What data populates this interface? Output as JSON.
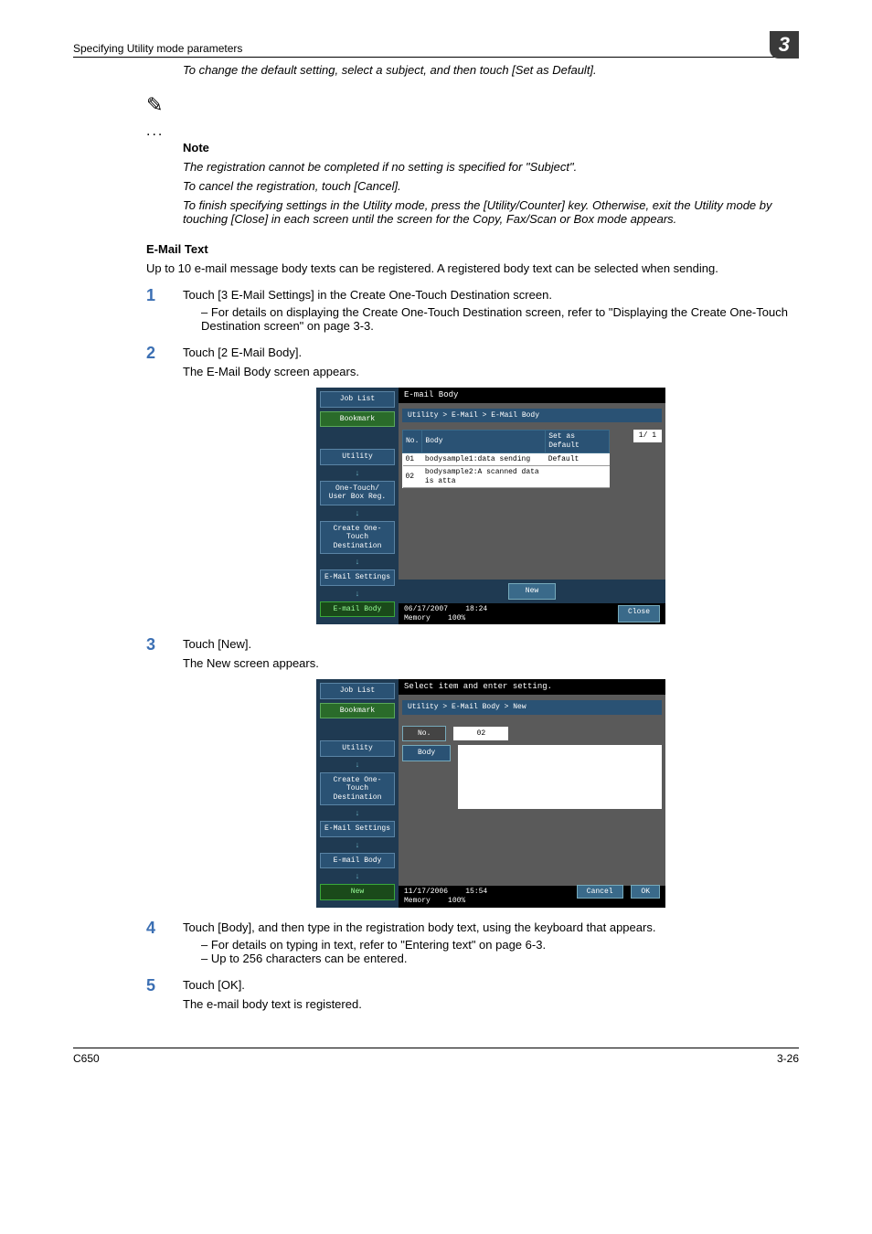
{
  "header": {
    "title": "Specifying Utility mode parameters",
    "chapter": "3"
  },
  "intro_italic": "To change the default setting, select a subject, and then touch [Set as Default].",
  "note": {
    "heading": "Note",
    "p1": "The registration cannot be completed if no setting is specified for \"Subject\".",
    "p2": "To cancel the registration, touch [Cancel].",
    "p3": "To finish specifying settings in the Utility mode, press the [Utility/Counter] key. Otherwise, exit the Utility mode by touching [Close] in each screen until the screen for the Copy, Fax/Scan or Box mode appears."
  },
  "section_title": "E-Mail Text",
  "section_intro": "Up to 10 e-mail message body texts can be registered. A registered body text can be selected when sending.",
  "steps": [
    {
      "num": "1",
      "text": "Touch [3 E-Mail Settings] in the Create One-Touch Destination screen.",
      "bullets": [
        "For details on displaying the Create One-Touch Destination screen, refer to \"Displaying the Create One-Touch Destination screen\" on page 3-3."
      ]
    },
    {
      "num": "2",
      "text": "Touch [2 E-Mail Body].",
      "after": "The E-Mail Body screen appears."
    },
    {
      "num": "3",
      "text": "Touch [New].",
      "after": "The New screen appears."
    },
    {
      "num": "4",
      "text": "Touch [Body], and then type in the registration body text, using the keyboard that appears.",
      "bullets": [
        "For details on typing in text, refer to \"Entering text\" on page 6-3.",
        "Up to 256 characters can be entered."
      ]
    },
    {
      "num": "5",
      "text": "Touch [OK].",
      "after": "The e-mail body text is registered."
    }
  ],
  "screen1": {
    "title": "E-mail Body",
    "crumb": "Utility > E-Mail > E-Mail Body",
    "page_indicator": "1/  1",
    "cols": {
      "no": "No.",
      "body": "Body",
      "def": "Set as Default"
    },
    "rows": [
      {
        "no": "01",
        "body": "bodysample1:data sending",
        "def": "Default"
      },
      {
        "no": "02",
        "body": "bodysample2:A scanned data is atta",
        "def": ""
      }
    ],
    "sidebar": {
      "job_list": "Job List",
      "bookmark": "Bookmark",
      "utility": "Utility",
      "onetouch": "One-Touch/\nUser Box Reg.",
      "create": "Create One-Touch\nDestination",
      "email_settings": "E-Mail Settings",
      "email_body": "E-mail Body"
    },
    "new_btn": "New",
    "close_btn": "Close",
    "status_date": "06/17/2007",
    "status_time": "18:24",
    "status_mem": "Memory",
    "status_mem_val": "100%"
  },
  "screen2": {
    "title": "Select item and enter setting.",
    "crumb": "Utility > E-Mail Body > New",
    "no_label": "No.",
    "no_value": "02",
    "body_label": "Body",
    "sidebar": {
      "job_list": "Job List",
      "bookmark": "Bookmark",
      "utility": "Utility",
      "create": "Create One-Touch\nDestination",
      "email_settings": "E-Mail Settings",
      "email_body": "E-mail Body",
      "new": "New"
    },
    "cancel_btn": "Cancel",
    "ok_btn": "OK",
    "status_date": "11/17/2006",
    "status_time": "15:54",
    "status_mem": "Memory",
    "status_mem_val": "100%"
  },
  "footer": {
    "left": "C650",
    "right": "3-26"
  }
}
